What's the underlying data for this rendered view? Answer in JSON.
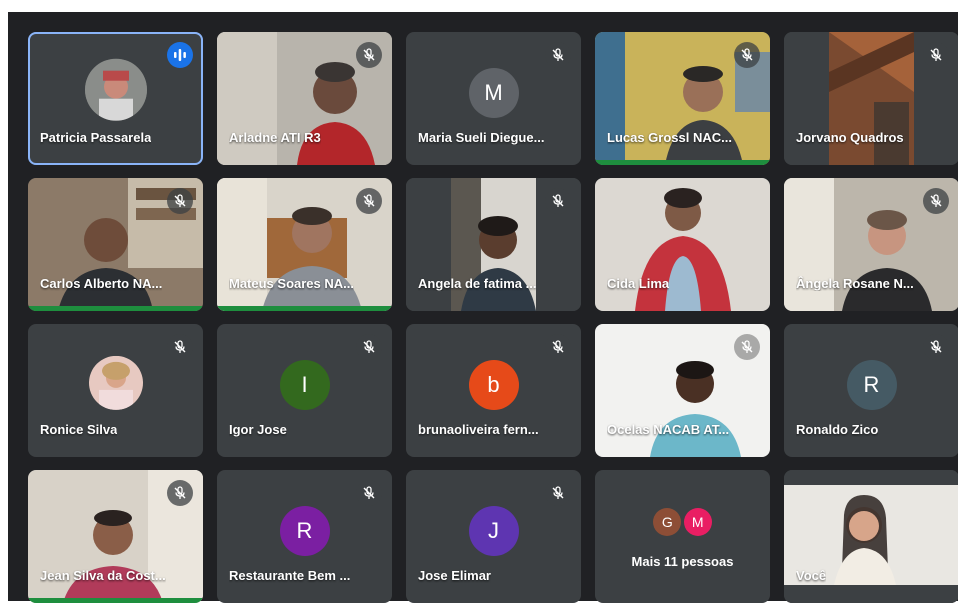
{
  "meeting": {
    "tiles": [
      {
        "name": "Patricia Passarela",
        "state": "speaking"
      },
      {
        "name": "Arladne ATI R3",
        "state": "muted"
      },
      {
        "name": "Maria Sueli Diegue...",
        "initial": "M",
        "avatar_color": "#5f6368",
        "state": "muted"
      },
      {
        "name": "Lucas Grossl NAC...",
        "state": "muted"
      },
      {
        "name": "Jorvano Quadros",
        "state": "muted"
      },
      {
        "name": "Carlos Alberto NA...",
        "state": "muted"
      },
      {
        "name": "Mateus Soares NA...",
        "state": "muted"
      },
      {
        "name": "Angela de fatima ...",
        "state": "muted"
      },
      {
        "name": "Cida Lima",
        "state": "unmuted"
      },
      {
        "name": "Ângela Rosane N...",
        "state": "muted"
      },
      {
        "name": "Ronice Silva",
        "state": "muted"
      },
      {
        "name": "Igor Jose",
        "initial": "I",
        "avatar_color": "#33691e",
        "state": "muted"
      },
      {
        "name": "brunaoliveira fern...",
        "initial": "b",
        "avatar_color": "#e64a19",
        "state": "muted"
      },
      {
        "name": "Ocelas NACAB AT...",
        "state": "muted"
      },
      {
        "name": "Ronaldo Zico",
        "initial": "R",
        "avatar_color": "#455a64",
        "state": "muted"
      },
      {
        "name": "Jean Silva da Cost...",
        "state": "muted"
      },
      {
        "name": "Restaurante Bem ...",
        "initial": "R",
        "avatar_color": "#7b1fa2",
        "state": "muted"
      },
      {
        "name": "Jose Elimar",
        "initial": "J",
        "avatar_color": "#5e35b1",
        "state": "muted"
      },
      {
        "more_label": "Mais 11 pessoas",
        "avatars": [
          {
            "initial": "G",
            "color": "#8d4e36"
          },
          {
            "initial": "M",
            "color": "#e91e63"
          }
        ]
      },
      {
        "name": "Você",
        "state": "self"
      }
    ]
  },
  "colors": {
    "background": "#202124",
    "tile": "#3c4043",
    "active_outline": "#8ab4f8",
    "speaking_badge": "#1a73e8",
    "talking_bar": "#1e8e3e"
  }
}
